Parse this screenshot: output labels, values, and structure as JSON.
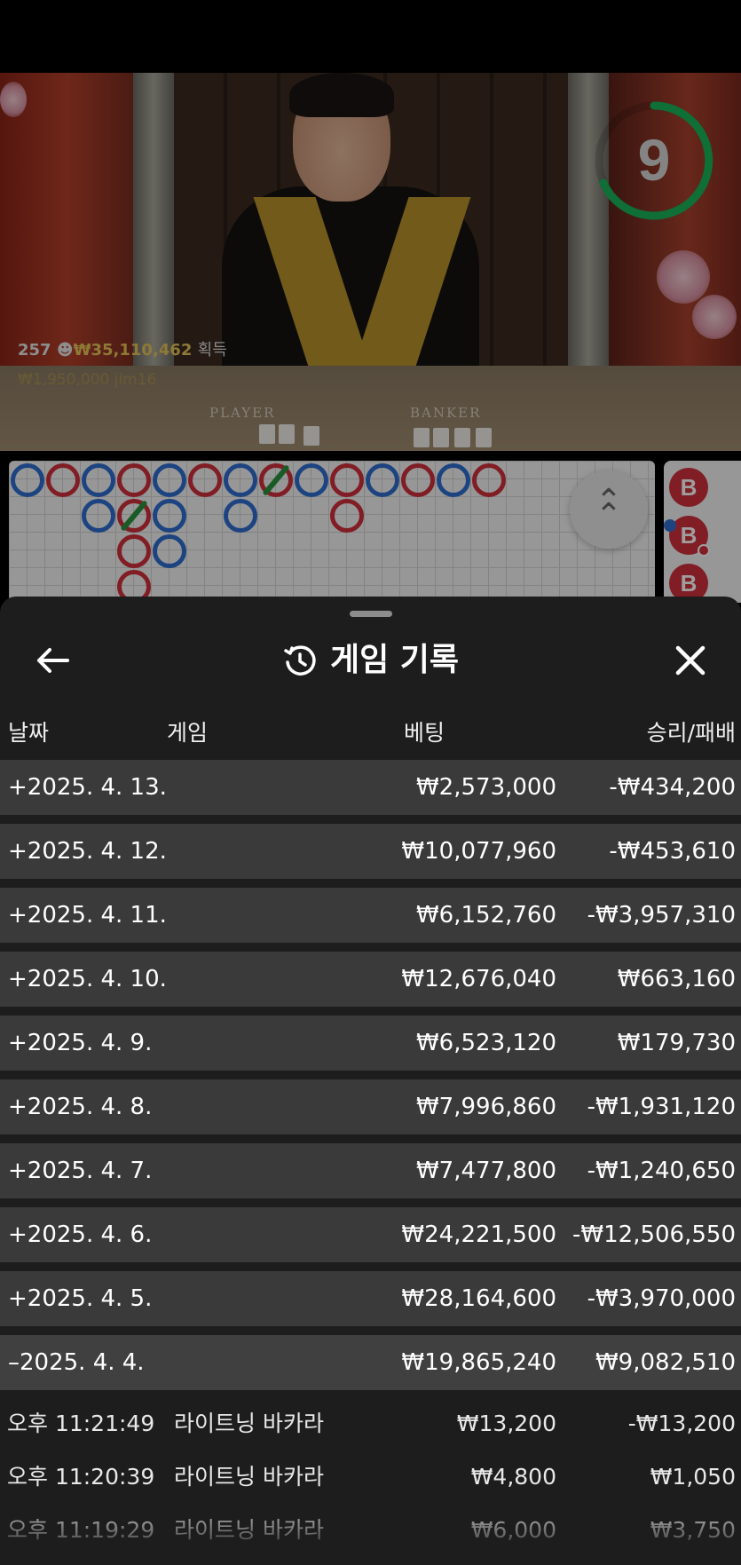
{
  "stream": {
    "timer": "9",
    "winners_count": "257",
    "winners_amount": "₩35,110,462",
    "winners_suffix": "획득",
    "top_winner": "₩1,950,000  jim16",
    "table_player_label": "PLAYER",
    "table_banker_label": "BANKER"
  },
  "roadmap": {
    "side_label": "B"
  },
  "sheet": {
    "title": "게임 기록",
    "columns": {
      "date": "날짜",
      "game": "게임",
      "bet": "베팅",
      "result": "승리/패배"
    },
    "days": [
      {
        "date": "+2025. 4. 13.",
        "bet": "₩2,573,000",
        "result": "-₩434,200"
      },
      {
        "date": "+2025. 4. 12.",
        "bet": "₩10,077,960",
        "result": "-₩453,610"
      },
      {
        "date": "+2025. 4. 11.",
        "bet": "₩6,152,760",
        "result": "-₩3,957,310"
      },
      {
        "date": "+2025. 4. 10.",
        "bet": "₩12,676,040",
        "result": "₩663,160"
      },
      {
        "date": "+2025. 4. 9.",
        "bet": "₩6,523,120",
        "result": "₩179,730"
      },
      {
        "date": "+2025. 4. 8.",
        "bet": "₩7,996,860",
        "result": "-₩1,931,120"
      },
      {
        "date": "+2025. 4. 7.",
        "bet": "₩7,477,800",
        "result": "-₩1,240,650"
      },
      {
        "date": "+2025. 4. 6.",
        "bet": "₩24,221,500",
        "result": "-₩12,506,550"
      },
      {
        "date": "+2025. 4. 5.",
        "bet": "₩28,164,600",
        "result": "-₩3,970,000"
      },
      {
        "date": "–2025. 4. 4.",
        "bet": "₩19,865,240",
        "result": "₩9,082,510"
      }
    ],
    "games": [
      {
        "time": "오후 11:21:49",
        "name": "라이트닝 바카라",
        "bet": "₩13,200",
        "result": "-₩13,200"
      },
      {
        "time": "오후 11:20:39",
        "name": "라이트닝 바카라",
        "bet": "₩4,800",
        "result": "₩1,050"
      },
      {
        "time": "오후 11:19:29",
        "name": "라이트닝 바카라",
        "bet": "₩6,000",
        "result": "₩3,750"
      }
    ]
  },
  "colors": {
    "player_blue": "#2f6fcf",
    "banker_red": "#d02f3a",
    "tie_green": "#29943e",
    "timer_green": "#19b35a",
    "winner_gold": "#e6c45a",
    "sheet_bg": "#1d1d1d",
    "row_bg": "#3a3a3a"
  },
  "icons": [
    "back-arrow-icon",
    "history-clock-icon",
    "close-x-icon",
    "double-chevron-up-icon",
    "person-icon"
  ]
}
